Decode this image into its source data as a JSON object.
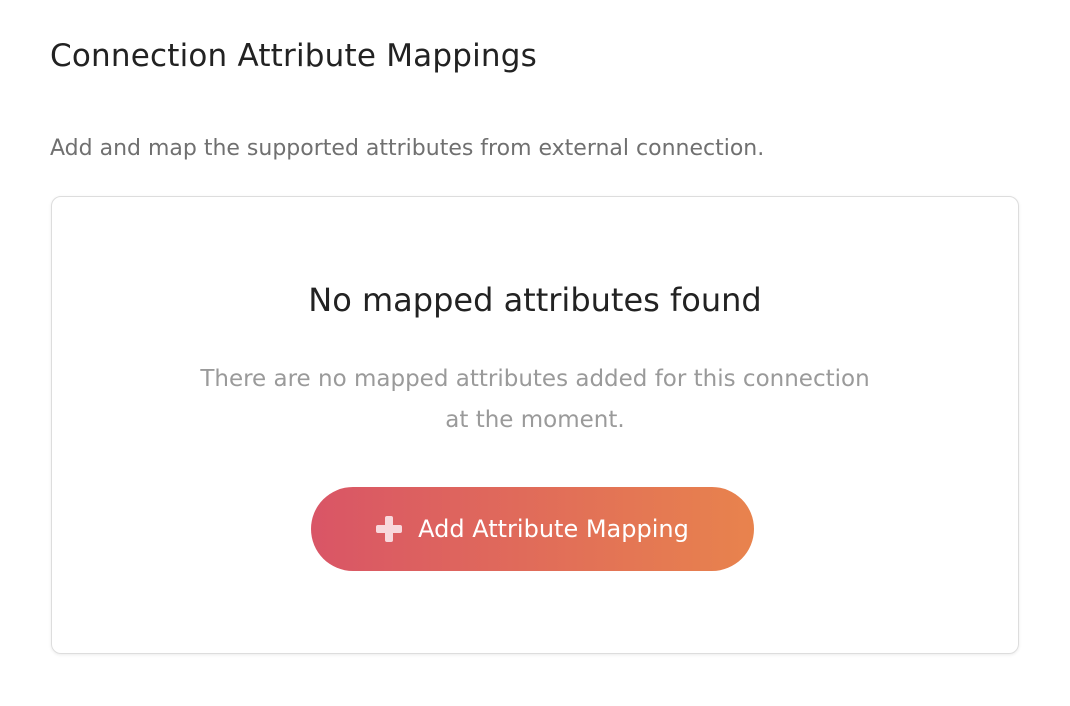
{
  "header": {
    "title": "Connection Attribute Mappings",
    "description": "Add and map the supported attributes from external connection."
  },
  "empty_state": {
    "title": "No mapped attributes found",
    "line1": "There are no mapped attributes added for this connection",
    "line2": "at the moment.",
    "button_label": "Add Attribute Mapping",
    "button_icon": "plus-icon"
  },
  "colors": {
    "gradient_start": "#d95566",
    "gradient_end": "#e8834d"
  }
}
